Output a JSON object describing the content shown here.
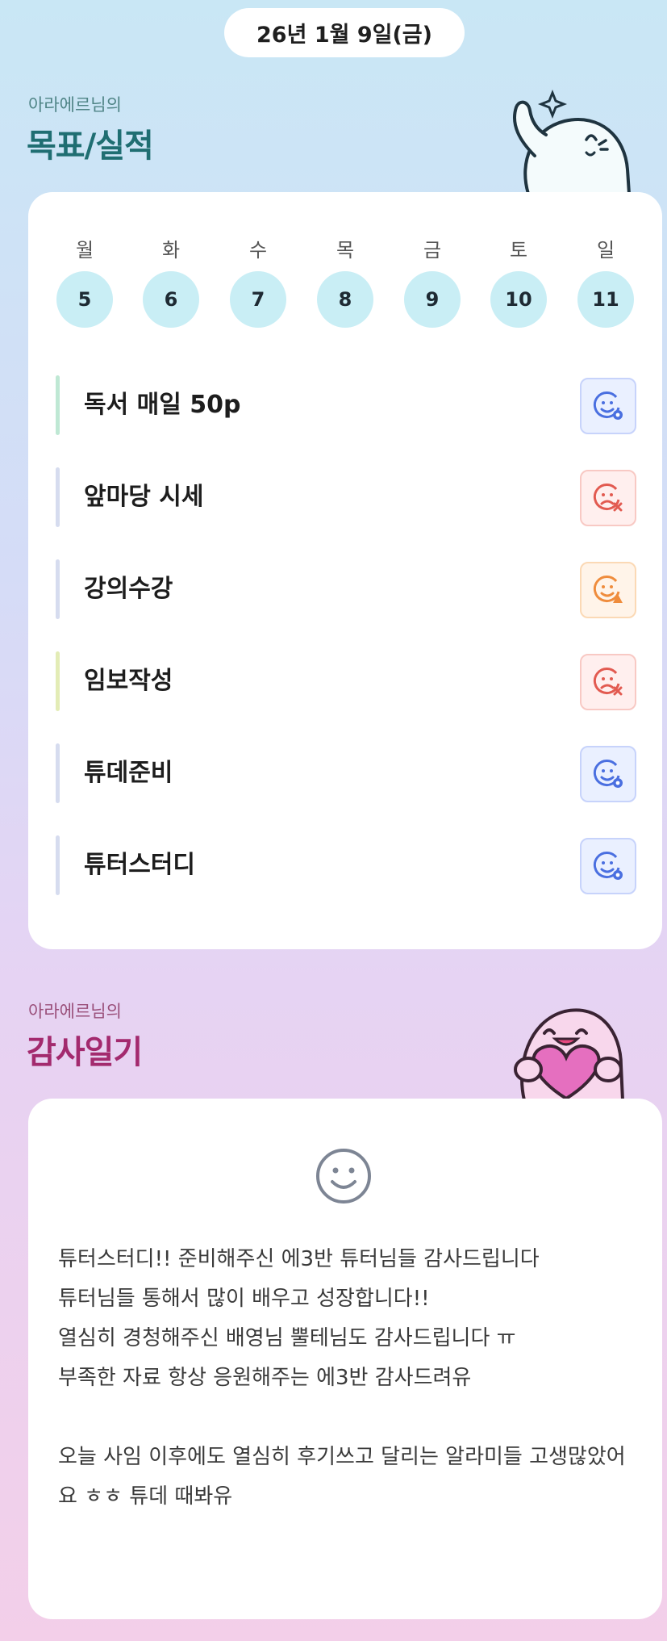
{
  "date": "26년 1월 9일(금)",
  "goals_section": {
    "subtitle": "아라에르님의",
    "title": "목표/실적",
    "title_color": "#1f6e72",
    "subtitle_color": "#4f8486"
  },
  "week": {
    "days": [
      {
        "label": "월",
        "num": "5"
      },
      {
        "label": "화",
        "num": "6"
      },
      {
        "label": "수",
        "num": "7"
      },
      {
        "label": "목",
        "num": "8"
      },
      {
        "label": "금",
        "num": "9"
      },
      {
        "label": "토",
        "num": "10"
      },
      {
        "label": "일",
        "num": "11"
      }
    ]
  },
  "goals": [
    {
      "label": "독서 매일 50p",
      "status": "done",
      "bar_color": "#bfe8d4"
    },
    {
      "label": "앞마당 시세",
      "status": "fail",
      "bar_color": "#d6dcef"
    },
    {
      "label": "강의수강",
      "status": "partial",
      "bar_color": "#d6dcef"
    },
    {
      "label": "임보작성",
      "status": "fail",
      "bar_color": "#e3ecb6"
    },
    {
      "label": "튜데준비",
      "status": "done",
      "bar_color": "#d6dcef"
    },
    {
      "label": "튜터스터디",
      "status": "done",
      "bar_color": "#d6dcef"
    }
  ],
  "status_styles": {
    "done": {
      "icon": "smile-check-icon",
      "color": "#4a6fe0",
      "bg": "#eaf0ff",
      "border": "#c7d3fb"
    },
    "fail": {
      "icon": "sad-x-icon",
      "color": "#e25a50",
      "bg": "#ffefee",
      "border": "#f8c9c4"
    },
    "partial": {
      "icon": "smile-triangle-icon",
      "color": "#ef8c3c",
      "bg": "#fff4e9",
      "border": "#fbd9b5"
    }
  },
  "gratitude_section": {
    "subtitle": "아라에르님의",
    "title": "감사일기",
    "title_color": "#a32a6e",
    "subtitle_color": "#9a4f7a"
  },
  "diary": {
    "mood_icon": "smile-face-icon",
    "text": "튜터스터디!! 준비해주신 에3반 튜터님들 감사드립니다\n튜터님들 통해서 많이 배우고 성장합니다!!\n열심히 경청해주신 배영님 뿔테님도 감사드립니다 ㅠ\n부족한 자료 항상 응원해주는 에3반 감사드려유\n\n오늘 사임 이후에도 열심히 후기쓰고 달리는 알라미들 고생많았어요 ㅎㅎ 튜데 때봐유"
  }
}
